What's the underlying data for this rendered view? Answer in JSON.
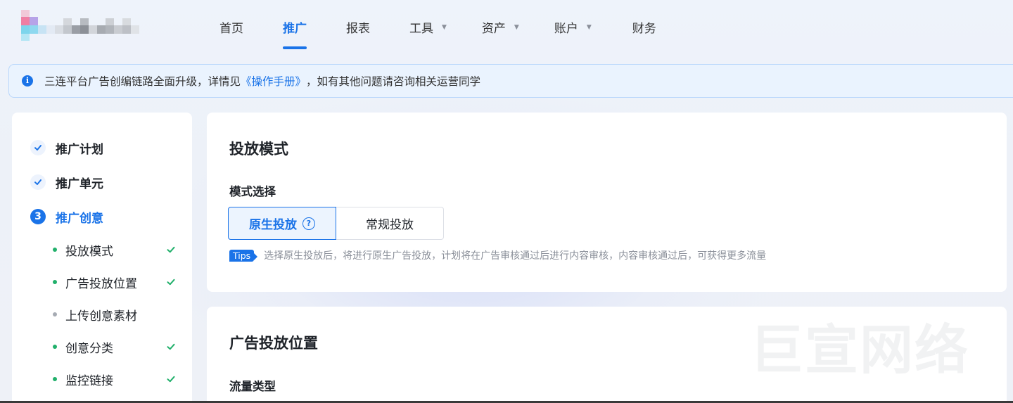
{
  "nav": {
    "items": [
      {
        "label": "首页",
        "has_dropdown": false,
        "active": false
      },
      {
        "label": "推广",
        "has_dropdown": false,
        "active": true
      },
      {
        "label": "报表",
        "has_dropdown": false,
        "active": false
      },
      {
        "label": "工具",
        "has_dropdown": true,
        "active": false
      },
      {
        "label": "资产",
        "has_dropdown": true,
        "active": false
      },
      {
        "label": "账户",
        "has_dropdown": true,
        "active": false
      },
      {
        "label": "财务",
        "has_dropdown": false,
        "active": false
      }
    ],
    "dropdown_icon": "caret-down-icon"
  },
  "notice": {
    "icon": "info-icon",
    "text_before": "三连平台广告创编链路全面升级，详情见",
    "link": "《操作手册》",
    "text_after": "，如有其他问题请咨询相关运营同学"
  },
  "sidebar": {
    "steps": [
      {
        "label": "推广计划",
        "status": "done"
      },
      {
        "label": "推广单元",
        "status": "done"
      },
      {
        "label": "推广创意",
        "status": "current",
        "number": "3"
      }
    ],
    "substeps": [
      {
        "label": "投放模式",
        "done": true
      },
      {
        "label": "广告投放位置",
        "done": true
      },
      {
        "label": "上传创意素材",
        "done": false
      },
      {
        "label": "创意分类",
        "done": true
      },
      {
        "label": "监控链接",
        "done": true
      }
    ]
  },
  "mode_card": {
    "title": "投放模式",
    "field_label": "模式选择",
    "options": [
      {
        "label": "原生投放",
        "selected": true,
        "help_icon": "question-circle-icon"
      },
      {
        "label": "常规投放",
        "selected": false
      }
    ],
    "tips_badge": "Tips",
    "tips_text": "选择原生投放后，将进行原生广告投放，计划将在广告审核通过后进行内容审核，内容审核通过后，可获得更多流量"
  },
  "position_card": {
    "title": "广告投放位置",
    "field_label": "流量类型",
    "watermark": "巨宣网络"
  },
  "colors": {
    "accent": "#1a73e8",
    "success": "#21b06b",
    "notice_bg": "#eaf3fe",
    "notice_border": "#b9d7fb"
  }
}
